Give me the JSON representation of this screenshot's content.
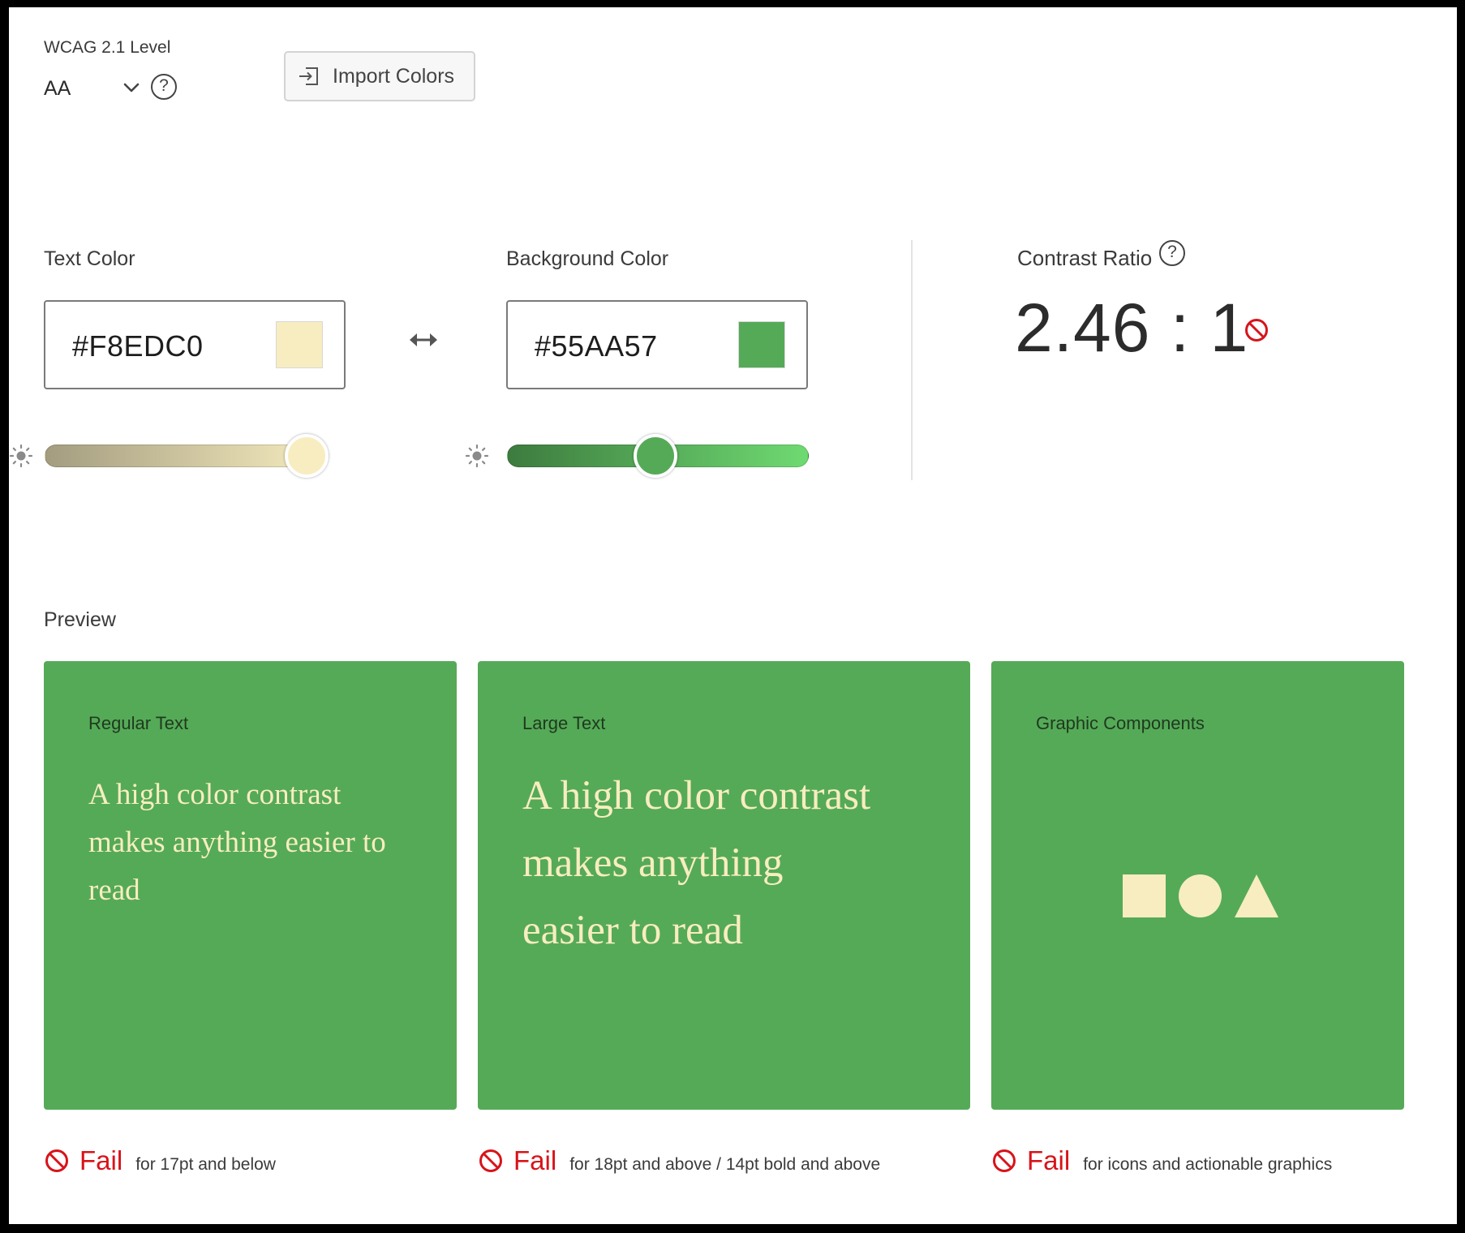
{
  "wcag": {
    "label": "WCAG 2.1 Level",
    "level": "AA",
    "chevron_icon": "chevron-down-icon",
    "help_icon": "help-icon",
    "help_glyph": "?"
  },
  "import_button": {
    "label": "Import Colors",
    "icon": "import-icon"
  },
  "text_color": {
    "label": "Text Color",
    "hex_display": "#F8EDC0",
    "value": "#F8EDC0",
    "slider_gradient_start": "#a39c7f",
    "slider_gradient_end": "#f8edc0",
    "slider_level": 1.0,
    "slider_icon": "brightness-icon"
  },
  "swap_icon": "swap-icon",
  "background_color": {
    "label": "Background Color",
    "hex_display": "#55AA57",
    "value": "#55AA57",
    "slider_gradient_start": "#3d7b3f",
    "slider_gradient_end": "#6fda72",
    "slider_level": 0.53,
    "slider_icon": "brightness-icon"
  },
  "contrast": {
    "label": "Contrast Ratio",
    "value": "2.46 : 1",
    "help_icon": "help-icon",
    "help_glyph": "?",
    "status_icon": "fail-icon"
  },
  "preview": {
    "label": "Preview",
    "cards": [
      {
        "title": "Regular Text",
        "sample": "A high color contrast makes anything easier to read"
      },
      {
        "title": "Large Text",
        "sample": "A high color contrast makes anything easier to read"
      },
      {
        "title": "Graphic Components",
        "shapes": [
          "square",
          "circle",
          "triangle"
        ]
      }
    ],
    "results": [
      {
        "status": "Fail",
        "desc": "for 17pt and below",
        "icon": "fail-icon"
      },
      {
        "status": "Fail",
        "desc": "for 18pt and above / 14pt bold and above",
        "icon": "fail-icon"
      },
      {
        "status": "Fail",
        "desc": "for icons and actionable graphics",
        "icon": "fail-icon"
      }
    ]
  },
  "colors": {
    "fail_red": "#d7141a",
    "card_background": "#55AA57",
    "card_foreground": "#F8EDC0"
  }
}
